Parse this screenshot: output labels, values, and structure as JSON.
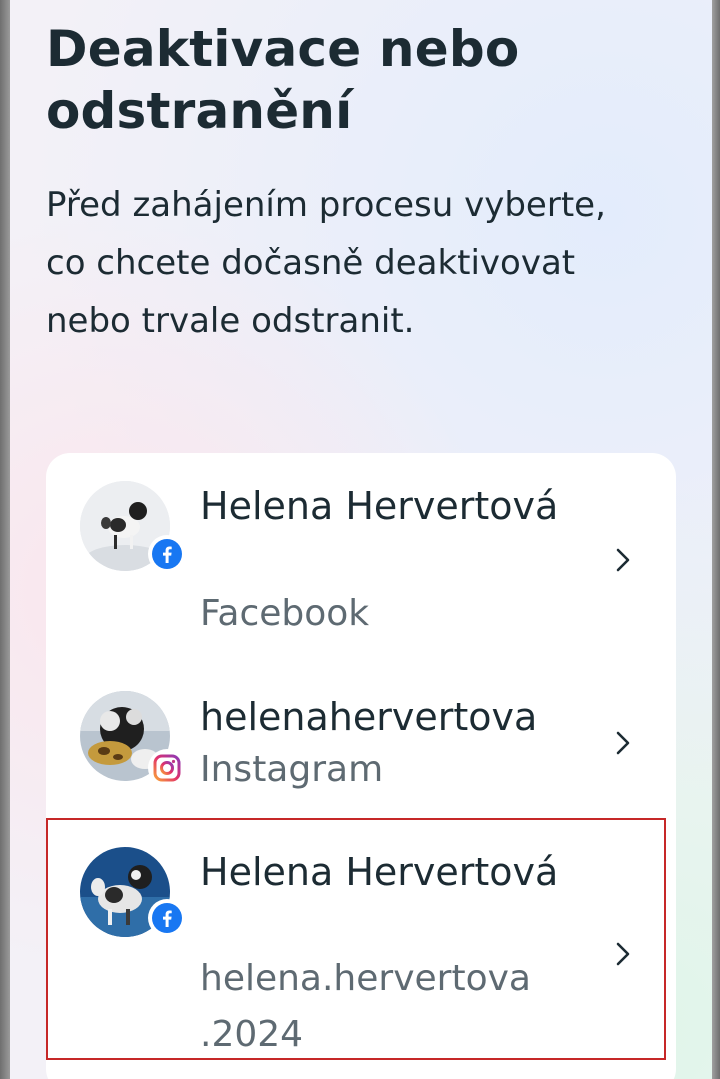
{
  "header": {
    "title": "Deaktivace nebo odstranění",
    "description": "Před zahájením procesu vyberte, co chcete dočasně deaktivovat nebo trvale odstranit."
  },
  "accounts": [
    {
      "name": "Helena Hervertová",
      "platform": "Facebook",
      "badge_icon": "facebook-icon"
    },
    {
      "name": "helenahervertova",
      "platform": "Instagram",
      "badge_icon": "instagram-icon"
    },
    {
      "name": "Helena Hervertová",
      "platform": "helena.hervertova .2024",
      "badge_icon": "facebook-icon"
    }
  ],
  "colors": {
    "facebook": "#1877f2",
    "instagram": "#dd2a7b",
    "text_primary": "#1c2b33",
    "text_secondary": "#5e6a72",
    "highlight": "#c62828"
  }
}
